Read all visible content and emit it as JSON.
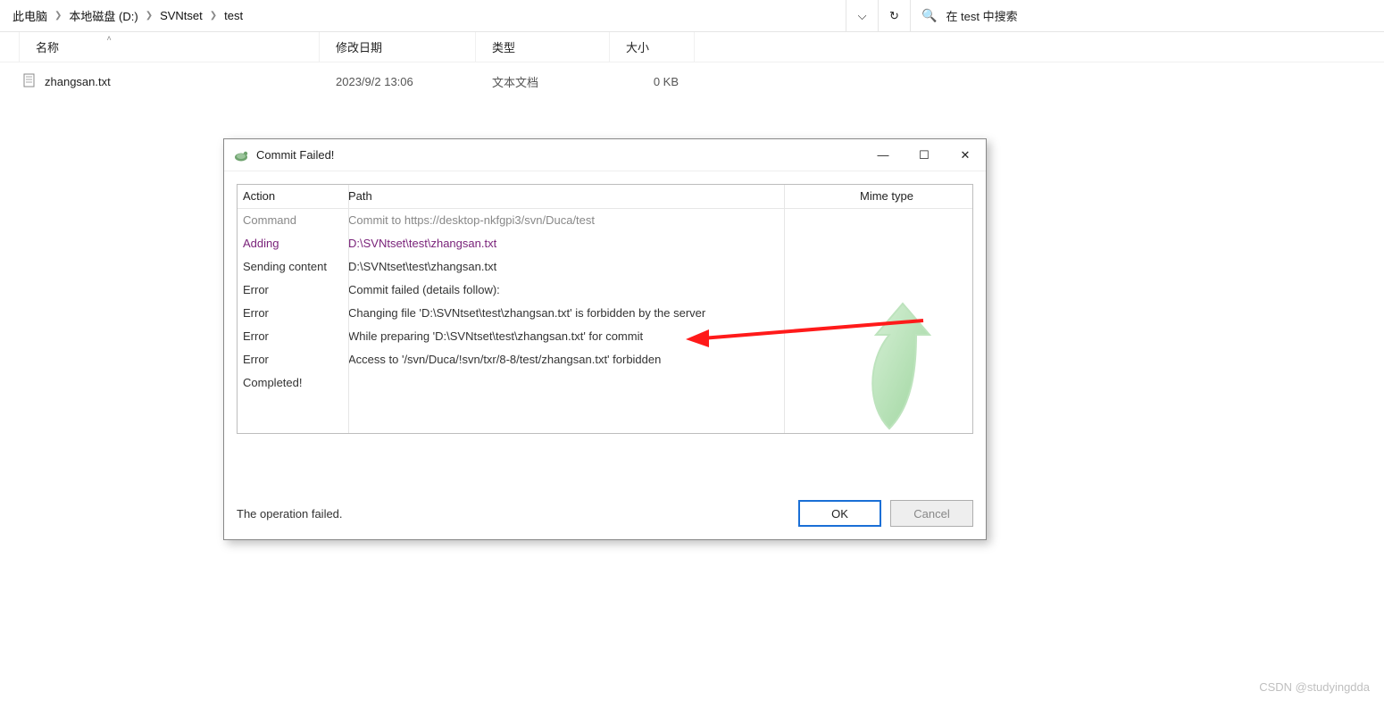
{
  "breadcrumb": {
    "p0": "此电脑",
    "p1": "本地磁盘 (D:)",
    "p2": "SVNtset",
    "p3": "test"
  },
  "search": {
    "placeholder": "在 test 中搜索"
  },
  "columns": {
    "name": "名称",
    "date": "修改日期",
    "type": "类型",
    "size": "大小"
  },
  "file": {
    "name": "zhangsan.txt",
    "date": "2023/9/2 13:06",
    "type": "文本文档",
    "size": "0 KB"
  },
  "dialog": {
    "title": "Commit Failed!",
    "headers": {
      "action": "Action",
      "path": "Path",
      "mime": "Mime type"
    },
    "rows": {
      "r0": {
        "action": "Command",
        "path": "Commit to https://desktop-nkfgpi3/svn/Duca/test"
      },
      "r1": {
        "action": "Adding",
        "path": "D:\\SVNtset\\test\\zhangsan.txt"
      },
      "r2": {
        "action": "Sending content",
        "path": "D:\\SVNtset\\test\\zhangsan.txt"
      },
      "r3": {
        "action": "Error",
        "path": "Commit failed (details follow):"
      },
      "r4": {
        "action": "Error",
        "path": "Changing file 'D:\\SVNtset\\test\\zhangsan.txt' is forbidden by the server"
      },
      "r5": {
        "action": "Error",
        "path": "While preparing 'D:\\SVNtset\\test\\zhangsan.txt' for commit"
      },
      "r6": {
        "action": "Error",
        "path": "Access to '/svn/Duca/!svn/txr/8-8/test/zhangsan.txt' forbidden"
      },
      "r7": {
        "action": "Completed!",
        "path": ""
      }
    },
    "status": "The operation failed.",
    "ok": "OK",
    "cancel": "Cancel"
  },
  "watermark": "CSDN @studyingdda"
}
